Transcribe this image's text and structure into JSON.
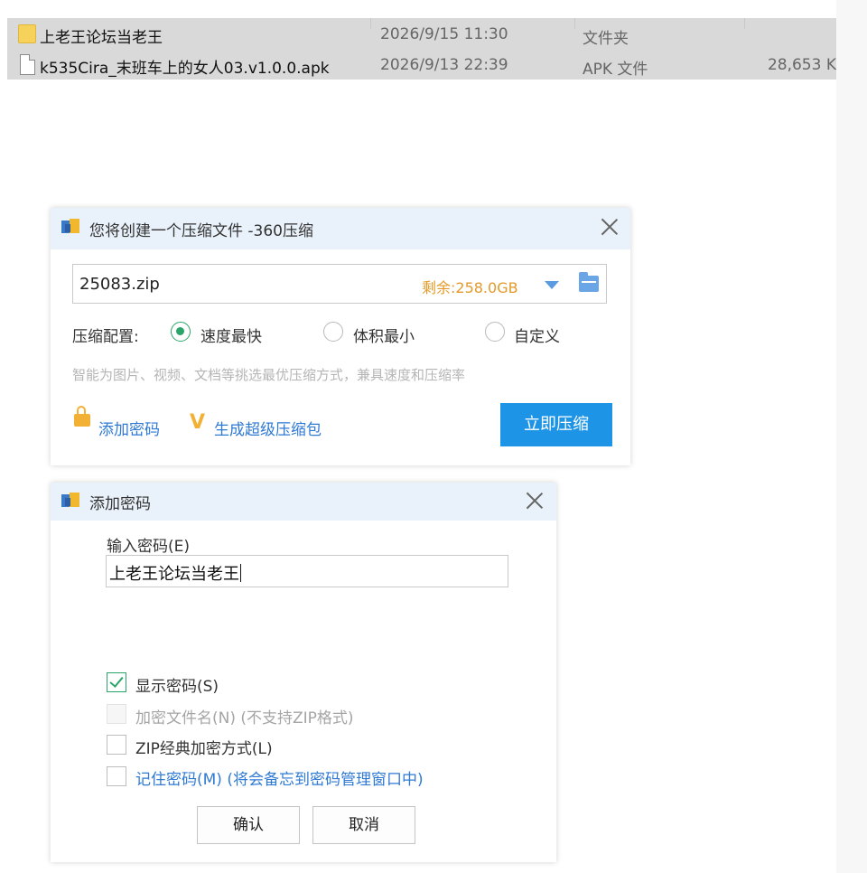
{
  "file_list": {
    "rows": [
      {
        "name": "上老王论坛当老王",
        "date": "2026/9/15 11:30",
        "type": "文件夹",
        "size": "",
        "icon": "folder-icon"
      },
      {
        "name": "k535Cira_末班车上的女人03.v1.0.0.apk",
        "date": "2026/9/13 22:39",
        "type": "APK 文件",
        "size": "28,653 K",
        "icon": "file-icon"
      }
    ]
  },
  "compress_dialog": {
    "title": "您将创建一个压缩文件 -360压缩",
    "path_value": "25083.zip",
    "space_left": "剩余:258.0GB",
    "config_label": "压缩配置:",
    "options": [
      {
        "label": "速度最快",
        "selected": true
      },
      {
        "label": "体积最小",
        "selected": false
      },
      {
        "label": "自定义",
        "selected": false
      }
    ],
    "hint": "智能为图片、视频、文档等挑选最优压缩方式，兼具速度和压缩率",
    "add_password_label": "添加密码",
    "super_pack_label": "生成超级压缩包",
    "super_pack_badge": "V",
    "compress_now_label": "立即压缩"
  },
  "password_dialog": {
    "title": "添加密码",
    "input_label": "输入密码(E)",
    "password_value": "上老王论坛当老王",
    "checkboxes": [
      {
        "label": "显示密码(S)",
        "checked": true,
        "disabled": false
      },
      {
        "label": "加密文件名(N) (不支持ZIP格式)",
        "checked": false,
        "disabled": true
      },
      {
        "label": "ZIP经典加密方式(L)",
        "checked": false,
        "disabled": false
      },
      {
        "label": "记住密码(M) (将会备忘到密码管理窗口中)",
        "checked": false,
        "disabled": false
      }
    ],
    "ok_label": "确认",
    "cancel_label": "取消"
  },
  "colors": {
    "accent_blue": "#1e94e6",
    "link_blue": "#2f7ad3",
    "radio_green": "#2aa56a",
    "space_orange": "#e39a2b",
    "selection_gray": "#d9d9d9"
  }
}
